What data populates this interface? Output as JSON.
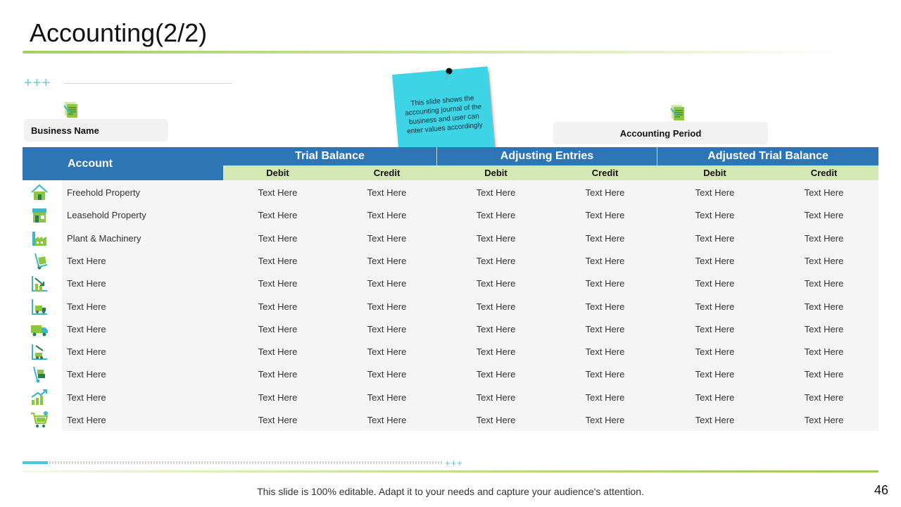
{
  "slide": {
    "title": "Accounting(2/2)",
    "business_label": "Business Name",
    "period_label": "Accounting Period",
    "note_text": "This slide shows the accounting journal of the business and user can enter values accordingly",
    "decor_plus": "+++",
    "footer_text": "This slide is 100% editable. Adapt it to your needs and capture your audience's attention.",
    "page_number": "46"
  },
  "table": {
    "account_header": "Account",
    "groups": [
      "Trial Balance",
      "Adjusting Entries",
      "Adjusted Trial Balance"
    ],
    "subheaders": [
      "Debit",
      "Credit",
      "Debit",
      "Credit",
      "Debit",
      "Credit"
    ],
    "rows": [
      {
        "icon": "house-icon",
        "label": "Freehold Property",
        "cells": [
          "Text Here",
          "Text Here",
          "Text Here",
          "Text Here",
          "Text Here",
          "Text Here"
        ]
      },
      {
        "icon": "store-icon",
        "label": "Leasehold Property",
        "cells": [
          "Text Here",
          "Text Here",
          "Text Here",
          "Text Here",
          "Text Here",
          "Text Here"
        ]
      },
      {
        "icon": "factory-icon",
        "label": "Plant & Machinery",
        "cells": [
          "Text Here",
          "Text Here",
          "Text Here",
          "Text Here",
          "Text Here",
          "Text Here"
        ]
      },
      {
        "icon": "hand-truck-icon",
        "label": "Text Here",
        "cells": [
          "Text Here",
          "Text Here",
          "Text Here",
          "Text Here",
          "Text Here",
          "Text Here"
        ]
      },
      {
        "icon": "chart-down-icon",
        "label": "Text Here",
        "cells": [
          "Text Here",
          "Text Here",
          "Text Here",
          "Text Here",
          "Text Here",
          "Text Here"
        ]
      },
      {
        "icon": "chart-truck-icon",
        "label": "Text Here",
        "cells": [
          "Text Here",
          "Text Here",
          "Text Here",
          "Text Here",
          "Text Here",
          "Text Here"
        ]
      },
      {
        "icon": "delivery-truck-icon",
        "label": "Text Here",
        "cells": [
          "Text Here",
          "Text Here",
          "Text Here",
          "Text Here",
          "Text Here",
          "Text Here"
        ]
      },
      {
        "icon": "chart-truck-down-icon",
        "label": "Text Here",
        "cells": [
          "Text Here",
          "Text Here",
          "Text Here",
          "Text Here",
          "Text Here",
          "Text Here"
        ]
      },
      {
        "icon": "trolley-icon",
        "label": "Text Here",
        "cells": [
          "Text Here",
          "Text Here",
          "Text Here",
          "Text Here",
          "Text Here",
          "Text Here"
        ]
      },
      {
        "icon": "growth-chart-icon",
        "label": "Text Here",
        "cells": [
          "Text Here",
          "Text Here",
          "Text Here",
          "Text Here",
          "Text Here",
          "Text Here"
        ]
      },
      {
        "icon": "shopping-cart-icon",
        "label": "Text Here",
        "cells": [
          "Text Here",
          "Text Here",
          "Text Here",
          "Text Here",
          "Text Here",
          "Text Here"
        ]
      }
    ]
  },
  "colors": {
    "header_blue": "#2e75b6",
    "subheader_green": "#d5e8b4",
    "accent_teal": "#48c9d8",
    "accent_green": "#a7cf5a",
    "note_cyan": "#3dd4e6"
  }
}
